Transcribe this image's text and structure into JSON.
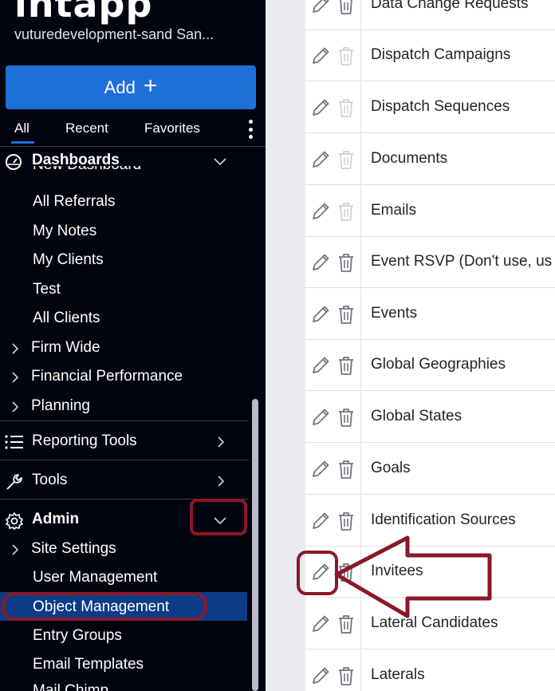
{
  "app": {
    "logo_text": "intapp",
    "instance_name": "vuturedevelopment-sand San...",
    "add_button_label": "Add"
  },
  "tabs": [
    "All",
    "Recent",
    "Favorites"
  ],
  "sidebar": {
    "dashboards": {
      "title": "Dashboards",
      "cut_item": "New Dashboard",
      "items": [
        "All Referrals",
        "My Notes",
        "My Clients",
        "Test",
        "All Clients"
      ],
      "groups": [
        "Firm Wide",
        "Financial Performance",
        "Planning"
      ]
    },
    "reporting_tools": "Reporting Tools",
    "tools": "Tools",
    "admin": {
      "title": "Admin",
      "group": "Site Settings",
      "items": [
        "User Management",
        "Object Management",
        "Entry Groups",
        "Email Templates"
      ],
      "cut_item": "Mail Chimp"
    }
  },
  "table": {
    "rows": [
      {
        "name": "Data Change Requests",
        "delete_enabled": true
      },
      {
        "name": "Dispatch Campaigns",
        "delete_enabled": false
      },
      {
        "name": "Dispatch Sequences",
        "delete_enabled": false
      },
      {
        "name": "Documents",
        "delete_enabled": false
      },
      {
        "name": "Emails",
        "delete_enabled": false
      },
      {
        "name": "Event RSVP (Don't use, us",
        "delete_enabled": true
      },
      {
        "name": "Events",
        "delete_enabled": true
      },
      {
        "name": "Global Geographies",
        "delete_enabled": true
      },
      {
        "name": "Global States",
        "delete_enabled": true
      },
      {
        "name": "Goals",
        "delete_enabled": true
      },
      {
        "name": "Identification Sources",
        "delete_enabled": true
      },
      {
        "name": "Invitees",
        "delete_enabled": true
      },
      {
        "name": "Lateral Candidates",
        "delete_enabled": true
      },
      {
        "name": "Laterals",
        "delete_enabled": true
      }
    ]
  },
  "icons": {
    "dashboards": "gauge-icon",
    "reporting_tools": "list-icon",
    "tools": "wrench-icon",
    "admin": "gear-icon",
    "edit": "pencil-icon",
    "delete": "trash-icon"
  },
  "colors": {
    "sidebar_bg": "#020410",
    "accent": "#1f6fd9",
    "selected_item": "#0c3c87",
    "annotation": "#8a1928",
    "icon_gray": "#707580",
    "icon_disabled": "#cfd3d8"
  }
}
